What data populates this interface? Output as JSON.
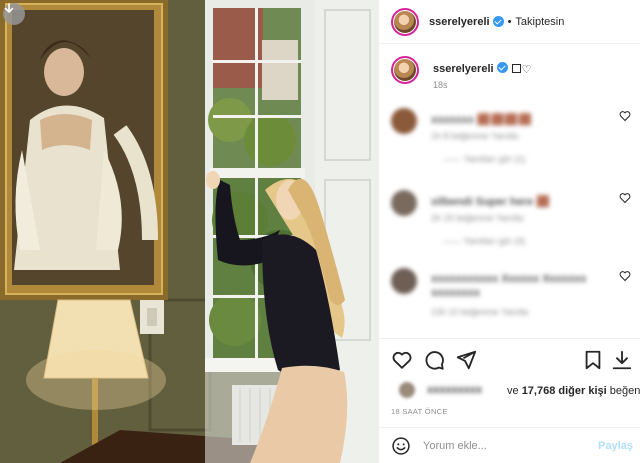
{
  "post": {
    "username": "sserelyereli",
    "follow_status": "Takiptesin",
    "separator": "•",
    "caption_emoji_heart": "♡",
    "caption_time": "18s"
  },
  "comments": [
    {
      "user": "blurred",
      "text": "blurred",
      "meta": "blurred",
      "sub": "blurred"
    },
    {
      "user": "blurred",
      "text": "blurred",
      "meta": "blurred",
      "sub": "blurred"
    },
    {
      "user": "blurred",
      "text": "blurred",
      "meta": "blurred"
    }
  ],
  "likes": {
    "connector": "ve",
    "count": "17,768",
    "rest": "diğer kişi",
    "verb": "beğendi"
  },
  "time_ago": "18 SAAT ÖNCE",
  "add_comment": {
    "placeholder": "Yorum ekle...",
    "post_label": "Paylaş"
  },
  "colors": {
    "verified": "#3897f0",
    "avatar_ring": "#d6249f",
    "post_button": "#b2dffc"
  }
}
